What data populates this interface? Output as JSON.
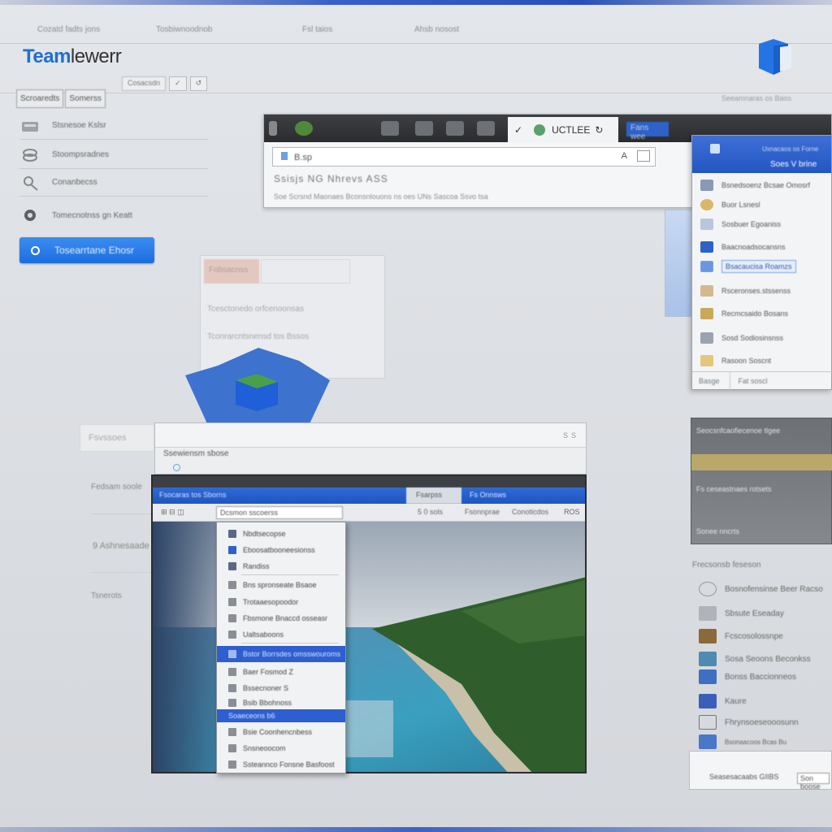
{
  "app": {
    "logo_main": "Team",
    "logo_rest": "lewerr"
  },
  "menubar": {
    "items": [
      "Cozatd fadts jons",
      "Tosbiwnoodnob",
      "Fsl taios",
      "Ahsb nosost"
    ]
  },
  "subtabs": [
    "Cosacsdn",
    "",
    ""
  ],
  "pills": [
    "Scroaredts",
    "Somerss"
  ],
  "right_hint": "Seeamnaras os Baos",
  "sidebar": {
    "items": [
      {
        "label": "Stsnesoe Kslsr"
      },
      {
        "label": "Stoompsradnes"
      },
      {
        "label": "Conanbecss"
      },
      {
        "label": "Tomecnotnss gn Keatt"
      }
    ],
    "primary_button": "Tosearrtane Ehosr"
  },
  "browser": {
    "active_tab": "UCTLEE",
    "blue_tab": "Fans wee",
    "url": "B.sp",
    "url_letter": "A",
    "bookmark_line": "Ssisjs  NG   Nhrevs   ASS",
    "bookmark_items": "Soe   Scrsnd Maonaes   Bconsnlouons ns oes UNs   Sascoa   Ssvo tsa"
  },
  "right_dialog": {
    "header_small": "Uxnacaos os Forne",
    "header_main": "Soes V brine",
    "items": [
      {
        "label": "Bsnedsoenz Bcsae Omosrf"
      },
      {
        "label": "Buor Lsnesl"
      },
      {
        "label": "Sosbuer Egoaniss"
      },
      {
        "label": "Baacnoadsocansns"
      },
      {
        "label": "Bsacaucisa Roamzs",
        "selected": true
      },
      {
        "label": "Rsceronses.stssenss"
      },
      {
        "label": "Recmcsaido Bosans"
      },
      {
        "label": "Sosd Sodiosinsnss"
      },
      {
        "label": "Rasoon Soscnt"
      }
    ],
    "footer_left": "Basge",
    "footer_right": "Fat soscl"
  },
  "ghost_panel": {
    "tab": "Fobsacnss",
    "rows": [
      "Tcesctonedo orfcenoonsas",
      "Tconrarcntsnensd tos Bssos"
    ]
  },
  "left_labels": [
    "Fedsam soole",
    "9 Ashnesaade",
    "Tsnerots"
  ],
  "dark_tile": {
    "lines": [
      "Seocsnfcaofiecenoe tlgee",
      "Fs ceseastnaes rotsets",
      "Sonee nncrts"
    ]
  },
  "secondary_window": {
    "tab": "Fsvssoes",
    "title": "Ssewiensm sbose",
    "controls": "SS"
  },
  "image_window": {
    "title": "Fsocaras tos Sborns",
    "tab_selected": "Fsarpss",
    "tab_right": "Fs Onnsws",
    "dropdown": "Dcsmon sscoerss",
    "tool_items": [
      "5 0  sols",
      "Fsonnprae",
      "Conoticdos",
      "ROS"
    ]
  },
  "context_menu": {
    "items": [
      {
        "label": "Nbdtsecopse"
      },
      {
        "label": "Eboosatbooneesionss"
      },
      {
        "label": "Randiss"
      },
      {
        "label": "Bns spronseate Bsaoe"
      },
      {
        "label": "Trotaaesopoodor"
      },
      {
        "label": "Fbsmone Bnaccd osseasr"
      },
      {
        "label": "Ualtsaboons"
      },
      {
        "label": "Bstor Borrsdes omsswouroms",
        "selected": true
      },
      {
        "label": "Baer Fosmod  Z"
      },
      {
        "label": "Bssecnoner  S"
      },
      {
        "label": "Bsib Bbohnoss"
      },
      {
        "label": "Soaeceons  b6",
        "selected": true
      },
      {
        "label": "Bsie Coonhencnbess"
      },
      {
        "label": "Snsneoocom"
      },
      {
        "label": "Ssteannco Fonsne Basfoost"
      }
    ]
  },
  "right_list": {
    "header": "Frecsonsb feseson",
    "items": [
      {
        "label": "Bosnofensinse Beer Racso"
      },
      {
        "label": "Sbsute Eseaday"
      },
      {
        "label": "Fcscosolossnpe"
      },
      {
        "label": "Sosa Seoons Beconkss"
      },
      {
        "label": "Bonss Baccionneos"
      },
      {
        "label": "Kaure"
      },
      {
        "label": "Fhrynsoeseooosunn"
      },
      {
        "label": "Bsonaacoos Bcas Bu"
      }
    ]
  },
  "status_box": {
    "text": "Seasesacaabs GIIBS",
    "field": "Son  boose"
  },
  "colors": {
    "accent": "#2e62c9",
    "primary_button": "#1c6ee0",
    "logo_blue": "#1f6fd0"
  }
}
